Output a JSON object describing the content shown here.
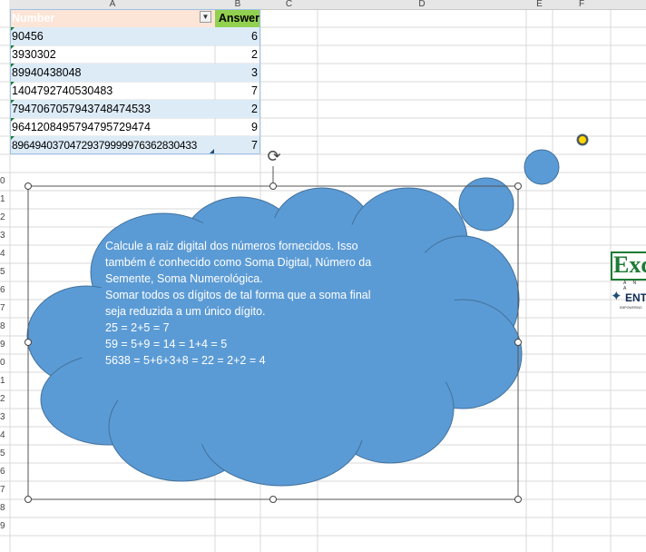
{
  "columns": [
    "A",
    "B",
    "C",
    "D",
    "E",
    "F"
  ],
  "rows": [
    "0",
    "1",
    "2",
    "3",
    "4",
    "5",
    "6",
    "7",
    "8",
    "9",
    "0",
    "1",
    "2",
    "3",
    "4",
    "5",
    "6",
    "7",
    "8",
    "9"
  ],
  "table": {
    "header_number": "Number",
    "header_answer": "Answer",
    "rows": [
      {
        "number": "90456",
        "answer": "6"
      },
      {
        "number": "3930302",
        "answer": "2"
      },
      {
        "number": "89940438048",
        "answer": "3"
      },
      {
        "number": "1404792740530483",
        "answer": "7"
      },
      {
        "number": "7947067057943748474533",
        "answer": "2"
      },
      {
        "number": "9641208495794795729474",
        "answer": "9"
      },
      {
        "number": "89649403704729379999976362830433",
        "answer": "7"
      }
    ]
  },
  "callout": {
    "lines": [
      "Calcule a raiz digital dos números fornecidos. Isso",
      "também é conhecido como Soma Digital, Número da",
      "Semente, Soma Numerológica.",
      "Somar todos os dígitos de tal forma que a soma final",
      "seja reduzida a um único dígito.",
      "25 = 2+5 = 7",
      "59 = 5+9 = 14 = 1+4 = 5",
      "5638 = 5+6+3+8 = 22 = 2+2 = 4"
    ],
    "fill_color": "#5b9bd5"
  },
  "logo": {
    "top_text": "Exc",
    "mid_text": "A N A",
    "bottom_text": "ENT",
    "tagline": "EMPOWERING"
  },
  "colors": {
    "header_a": "#fce4d6",
    "header_b": "#92d050",
    "band": "#ddebf7",
    "logo_green": "#1e7b34"
  }
}
